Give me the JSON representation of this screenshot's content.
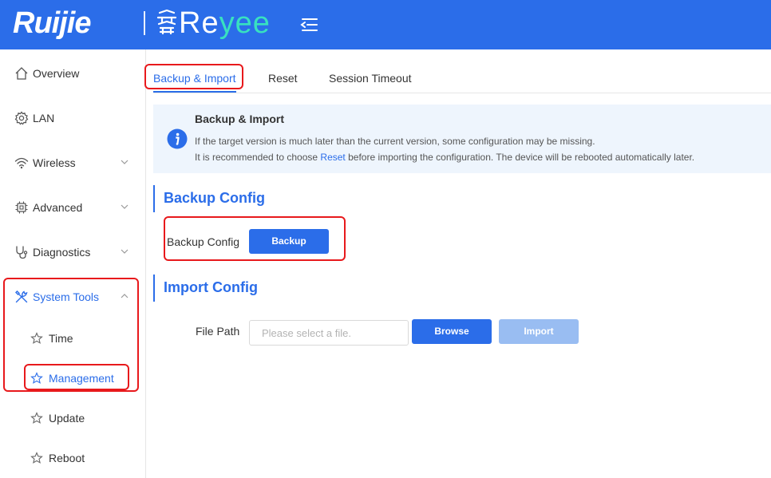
{
  "header": {
    "brand_ruijie": "Ruijie",
    "brand_reyee_main": "Re",
    "brand_reyee_accent": "yee",
    "brand_color": "#2b6de9",
    "accent_color": "#38e1c0"
  },
  "sidebar": {
    "items": [
      {
        "label": "Overview",
        "icon": "home-icon"
      },
      {
        "label": "LAN",
        "icon": "gear-icon"
      },
      {
        "label": "Wireless",
        "icon": "wifi-icon"
      },
      {
        "label": "Advanced",
        "icon": "chip-icon"
      },
      {
        "label": "Diagnostics",
        "icon": "stethoscope-icon"
      },
      {
        "label": "System Tools",
        "icon": "tools-icon"
      }
    ],
    "sub_items": [
      {
        "label": "Time",
        "icon": "star-icon"
      },
      {
        "label": "Management",
        "icon": "star-icon"
      },
      {
        "label": "Update",
        "icon": "star-icon"
      },
      {
        "label": "Reboot",
        "icon": "star-icon"
      }
    ]
  },
  "tabs": [
    {
      "label": "Backup & Import",
      "active": true
    },
    {
      "label": "Reset",
      "active": false
    },
    {
      "label": "Session Timeout",
      "active": false
    }
  ],
  "info": {
    "title": "Backup & Import",
    "line1": "If the target version is much later than the current version, some configuration may be missing.",
    "line2_prefix": "It is recommended to choose ",
    "line2_link": "Reset",
    "line2_suffix": " before importing the configuration. The device will be rebooted automatically later."
  },
  "backup": {
    "section_title": "Backup Config",
    "field_label": "Backup Config",
    "button": "Backup"
  },
  "import": {
    "section_title": "Import Config",
    "field_label": "File Path",
    "placeholder": "Please select a file.",
    "browse_button": "Browse",
    "import_button": "Import"
  },
  "highlight_color": "#e8191c"
}
